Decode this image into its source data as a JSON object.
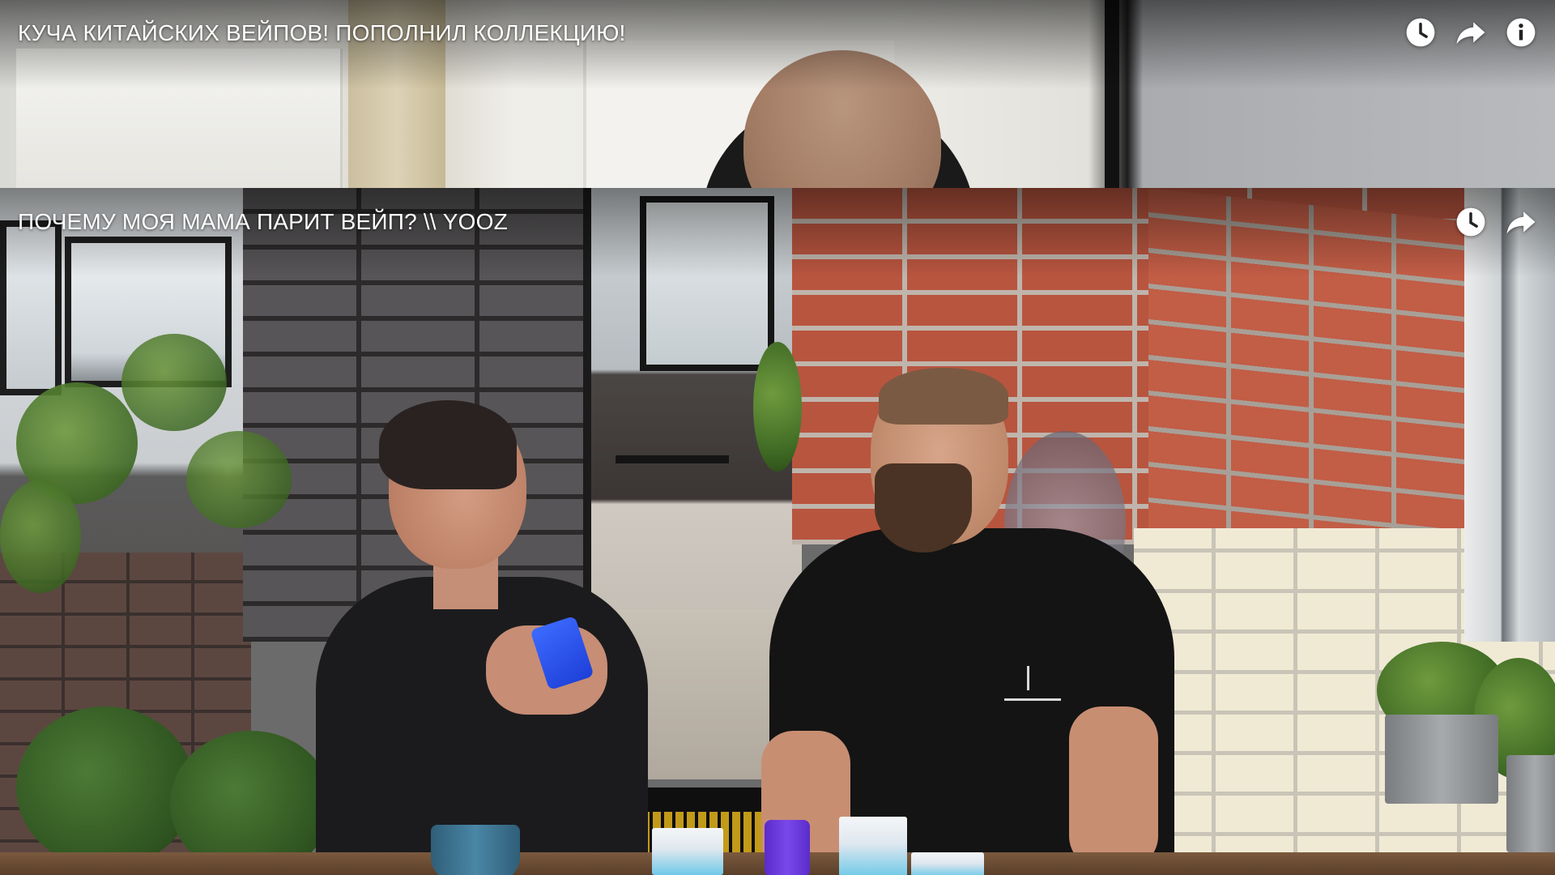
{
  "videos": [
    {
      "title": "КУЧА КИТАЙСКИХ ВЕЙПОВ! ПОПОЛНИЛ КОЛЛЕКЦИЮ!",
      "actions": [
        "watch-later-icon",
        "share-icon",
        "info-icon"
      ]
    },
    {
      "title": "ПОЧЕМУ МОЯ МАМА ПАРИТ ВЕЙП? \\\\ YOOZ",
      "actions": [
        "watch-later-icon",
        "share-icon"
      ]
    }
  ],
  "colors": {
    "overlay_text": "#ffffff"
  }
}
